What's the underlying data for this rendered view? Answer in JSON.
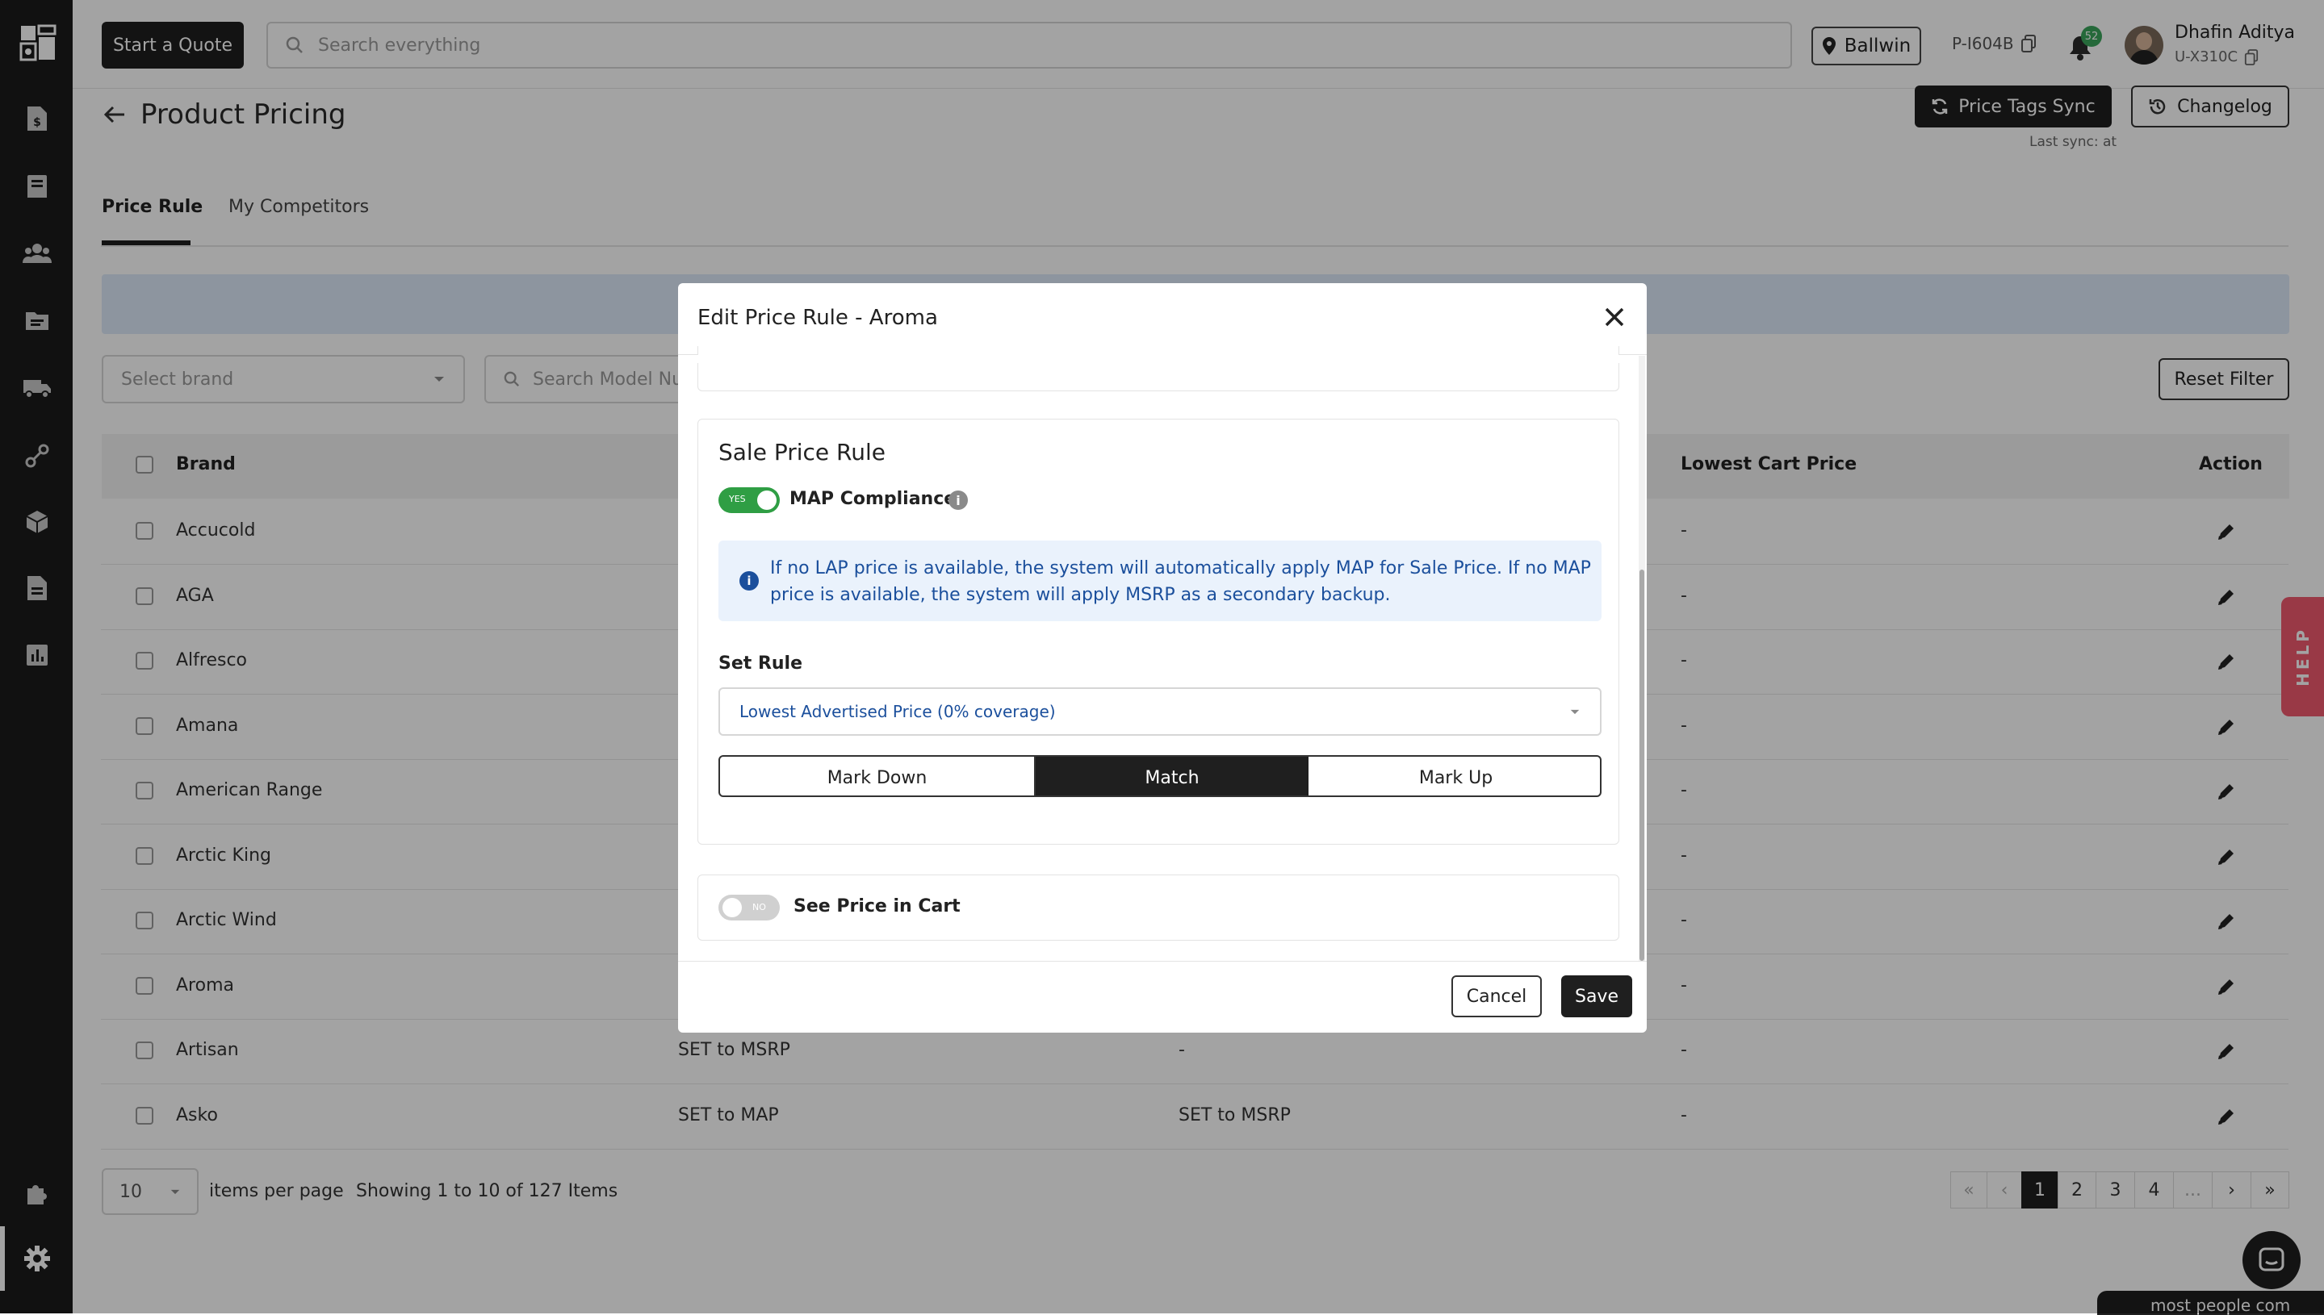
{
  "header": {
    "quote_button": "Start a Quote",
    "search_placeholder": "Search everything",
    "location": "Ballwin",
    "store_code": "P-I604B",
    "notification_count": "52",
    "user_name": "Dhafin Aditya",
    "user_code": "U-X310C"
  },
  "page": {
    "title": "Product Pricing",
    "sync_button": "Price Tags Sync",
    "changelog_button": "Changelog",
    "last_sync": "Last sync: at",
    "tabs": [
      {
        "label": "Price Rule",
        "active": true
      },
      {
        "label": "My Competitors",
        "active": false
      }
    ],
    "filters": {
      "brand_placeholder": "Select brand",
      "model_placeholder": "Search Model Nu",
      "reset_button": "Reset Filter"
    }
  },
  "table": {
    "headers": {
      "brand": "Brand",
      "lowest_cart": "Lowest Cart Price",
      "action": "Action"
    },
    "rows": [
      {
        "brand": "Accucold",
        "col2": "",
        "col3": "",
        "lowest_cart": "-"
      },
      {
        "brand": "AGA",
        "col2": "",
        "col3": "",
        "lowest_cart": "-"
      },
      {
        "brand": "Alfresco",
        "col2": "",
        "col3": "",
        "lowest_cart": "-"
      },
      {
        "brand": "Amana",
        "col2": "",
        "col3": "",
        "lowest_cart": "-"
      },
      {
        "brand": "American Range",
        "col2": "",
        "col3": "",
        "lowest_cart": "-"
      },
      {
        "brand": "Arctic King",
        "col2": "",
        "col3": "",
        "lowest_cart": "-"
      },
      {
        "brand": "Arctic Wind",
        "col2": "",
        "col3": "",
        "lowest_cart": "-"
      },
      {
        "brand": "Aroma",
        "col2": "",
        "col3": "",
        "lowest_cart": "-"
      },
      {
        "brand": "Artisan",
        "col2": "SET to MSRP",
        "col3": "-",
        "lowest_cart": "-"
      },
      {
        "brand": "Asko",
        "col2": "SET to MAP",
        "col3": "SET to MSRP",
        "lowest_cart": "-"
      }
    ]
  },
  "pagination": {
    "per_page_value": "10",
    "per_page_label": "items per page",
    "showing": "Showing 1 to 10 of 127 Items",
    "first": "«",
    "prev": "‹",
    "pages": [
      "1",
      "2",
      "3",
      "4"
    ],
    "ellipsis": "...",
    "next": "›",
    "last": "»",
    "current_page": "1"
  },
  "help_tab": "HELP",
  "chat_bubble": "most people com",
  "modal": {
    "title": "Edit Price Rule - Aroma",
    "section_title": "Sale Price Rule",
    "map_toggle_state": "YES",
    "map_label": "MAP Compliance",
    "info_text_line1": "If no LAP price is available, the system will automatically apply MAP for Sale Price. If no MAP",
    "info_text_line2": "price is available, the system will apply MSRP as a secondary backup.",
    "set_rule_label": "Set Rule",
    "set_rule_value": "Lowest Advertised Price (0% coverage)",
    "segments": [
      {
        "label": "Mark Down",
        "active": false
      },
      {
        "label": "Match",
        "active": true
      },
      {
        "label": "Mark Up",
        "active": false
      }
    ],
    "cart_toggle_state": "NO",
    "cart_label": "See Price in Cart",
    "cancel_button": "Cancel",
    "save_button": "Save"
  },
  "colors": {
    "accent_dark": "#1f1f1f",
    "toggle_on": "#2f9e44",
    "info_bg": "#eaf2fc",
    "info_text": "#1b4f9c",
    "help_tab": "#f05a6e"
  }
}
